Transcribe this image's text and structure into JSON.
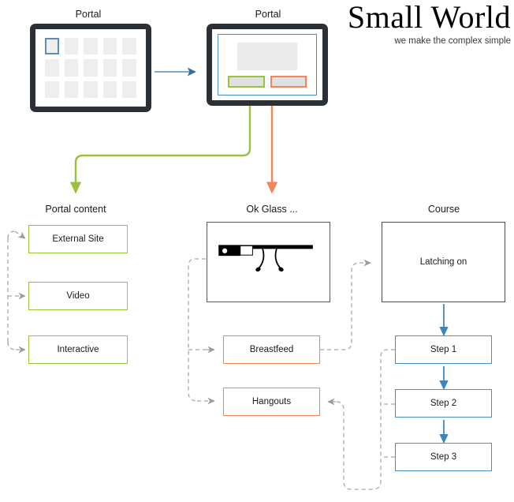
{
  "brand": {
    "name": "Small World",
    "tagline": "we make the complex simple"
  },
  "devices": {
    "portal_1": {
      "label": "Portal",
      "tile_count": 15,
      "selected_tile_index": 0
    },
    "portal_2": {
      "label": "Portal",
      "green_region_label": "",
      "orange_region_label": ""
    }
  },
  "columns": {
    "portal_content": {
      "title": "Portal content",
      "items": [
        {
          "label": "External Site"
        },
        {
          "label": "Video"
        },
        {
          "label": "Interactive"
        }
      ]
    },
    "ok_glass": {
      "title": "Ok Glass ...",
      "illustration": "google-glass",
      "items": [
        {
          "label": "Breastfeed"
        },
        {
          "label": "Hangouts"
        }
      ]
    },
    "course": {
      "title": "Course",
      "primary": {
        "label": "Latching on"
      },
      "steps": [
        {
          "label": "Step 1"
        },
        {
          "label": "Step 2"
        },
        {
          "label": "Step 3"
        }
      ]
    }
  },
  "colors": {
    "green": "#9ac23c",
    "orange": "#f0865a",
    "blue": "#4a90c4",
    "dark": "#4a4a4a",
    "dashed_gray": "#a8a8a8",
    "device_body": "#2b3036",
    "tile": "#eeeeee"
  }
}
